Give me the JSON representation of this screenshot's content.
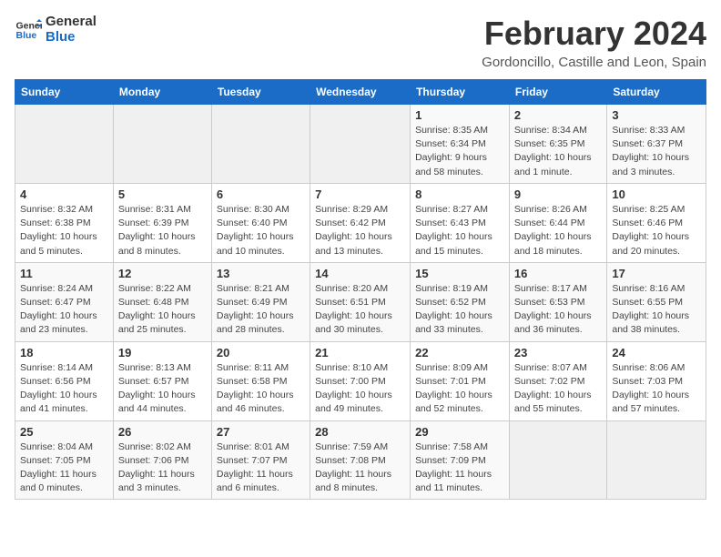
{
  "header": {
    "logo": "GeneralBlue",
    "month": "February 2024",
    "location": "Gordoncillo, Castille and Leon, Spain"
  },
  "weekdays": [
    "Sunday",
    "Monday",
    "Tuesday",
    "Wednesday",
    "Thursday",
    "Friday",
    "Saturday"
  ],
  "weeks": [
    [
      {
        "day": "",
        "info": ""
      },
      {
        "day": "",
        "info": ""
      },
      {
        "day": "",
        "info": ""
      },
      {
        "day": "",
        "info": ""
      },
      {
        "day": "1",
        "info": "Sunrise: 8:35 AM\nSunset: 6:34 PM\nDaylight: 9 hours\nand 58 minutes."
      },
      {
        "day": "2",
        "info": "Sunrise: 8:34 AM\nSunset: 6:35 PM\nDaylight: 10 hours\nand 1 minute."
      },
      {
        "day": "3",
        "info": "Sunrise: 8:33 AM\nSunset: 6:37 PM\nDaylight: 10 hours\nand 3 minutes."
      }
    ],
    [
      {
        "day": "4",
        "info": "Sunrise: 8:32 AM\nSunset: 6:38 PM\nDaylight: 10 hours\nand 5 minutes."
      },
      {
        "day": "5",
        "info": "Sunrise: 8:31 AM\nSunset: 6:39 PM\nDaylight: 10 hours\nand 8 minutes."
      },
      {
        "day": "6",
        "info": "Sunrise: 8:30 AM\nSunset: 6:40 PM\nDaylight: 10 hours\nand 10 minutes."
      },
      {
        "day": "7",
        "info": "Sunrise: 8:29 AM\nSunset: 6:42 PM\nDaylight: 10 hours\nand 13 minutes."
      },
      {
        "day": "8",
        "info": "Sunrise: 8:27 AM\nSunset: 6:43 PM\nDaylight: 10 hours\nand 15 minutes."
      },
      {
        "day": "9",
        "info": "Sunrise: 8:26 AM\nSunset: 6:44 PM\nDaylight: 10 hours\nand 18 minutes."
      },
      {
        "day": "10",
        "info": "Sunrise: 8:25 AM\nSunset: 6:46 PM\nDaylight: 10 hours\nand 20 minutes."
      }
    ],
    [
      {
        "day": "11",
        "info": "Sunrise: 8:24 AM\nSunset: 6:47 PM\nDaylight: 10 hours\nand 23 minutes."
      },
      {
        "day": "12",
        "info": "Sunrise: 8:22 AM\nSunset: 6:48 PM\nDaylight: 10 hours\nand 25 minutes."
      },
      {
        "day": "13",
        "info": "Sunrise: 8:21 AM\nSunset: 6:49 PM\nDaylight: 10 hours\nand 28 minutes."
      },
      {
        "day": "14",
        "info": "Sunrise: 8:20 AM\nSunset: 6:51 PM\nDaylight: 10 hours\nand 30 minutes."
      },
      {
        "day": "15",
        "info": "Sunrise: 8:19 AM\nSunset: 6:52 PM\nDaylight: 10 hours\nand 33 minutes."
      },
      {
        "day": "16",
        "info": "Sunrise: 8:17 AM\nSunset: 6:53 PM\nDaylight: 10 hours\nand 36 minutes."
      },
      {
        "day": "17",
        "info": "Sunrise: 8:16 AM\nSunset: 6:55 PM\nDaylight: 10 hours\nand 38 minutes."
      }
    ],
    [
      {
        "day": "18",
        "info": "Sunrise: 8:14 AM\nSunset: 6:56 PM\nDaylight: 10 hours\nand 41 minutes."
      },
      {
        "day": "19",
        "info": "Sunrise: 8:13 AM\nSunset: 6:57 PM\nDaylight: 10 hours\nand 44 minutes."
      },
      {
        "day": "20",
        "info": "Sunrise: 8:11 AM\nSunset: 6:58 PM\nDaylight: 10 hours\nand 46 minutes."
      },
      {
        "day": "21",
        "info": "Sunrise: 8:10 AM\nSunset: 7:00 PM\nDaylight: 10 hours\nand 49 minutes."
      },
      {
        "day": "22",
        "info": "Sunrise: 8:09 AM\nSunset: 7:01 PM\nDaylight: 10 hours\nand 52 minutes."
      },
      {
        "day": "23",
        "info": "Sunrise: 8:07 AM\nSunset: 7:02 PM\nDaylight: 10 hours\nand 55 minutes."
      },
      {
        "day": "24",
        "info": "Sunrise: 8:06 AM\nSunset: 7:03 PM\nDaylight: 10 hours\nand 57 minutes."
      }
    ],
    [
      {
        "day": "25",
        "info": "Sunrise: 8:04 AM\nSunset: 7:05 PM\nDaylight: 11 hours\nand 0 minutes."
      },
      {
        "day": "26",
        "info": "Sunrise: 8:02 AM\nSunset: 7:06 PM\nDaylight: 11 hours\nand 3 minutes."
      },
      {
        "day": "27",
        "info": "Sunrise: 8:01 AM\nSunset: 7:07 PM\nDaylight: 11 hours\nand 6 minutes."
      },
      {
        "day": "28",
        "info": "Sunrise: 7:59 AM\nSunset: 7:08 PM\nDaylight: 11 hours\nand 8 minutes."
      },
      {
        "day": "29",
        "info": "Sunrise: 7:58 AM\nSunset: 7:09 PM\nDaylight: 11 hours\nand 11 minutes."
      },
      {
        "day": "",
        "info": ""
      },
      {
        "day": "",
        "info": ""
      }
    ]
  ]
}
